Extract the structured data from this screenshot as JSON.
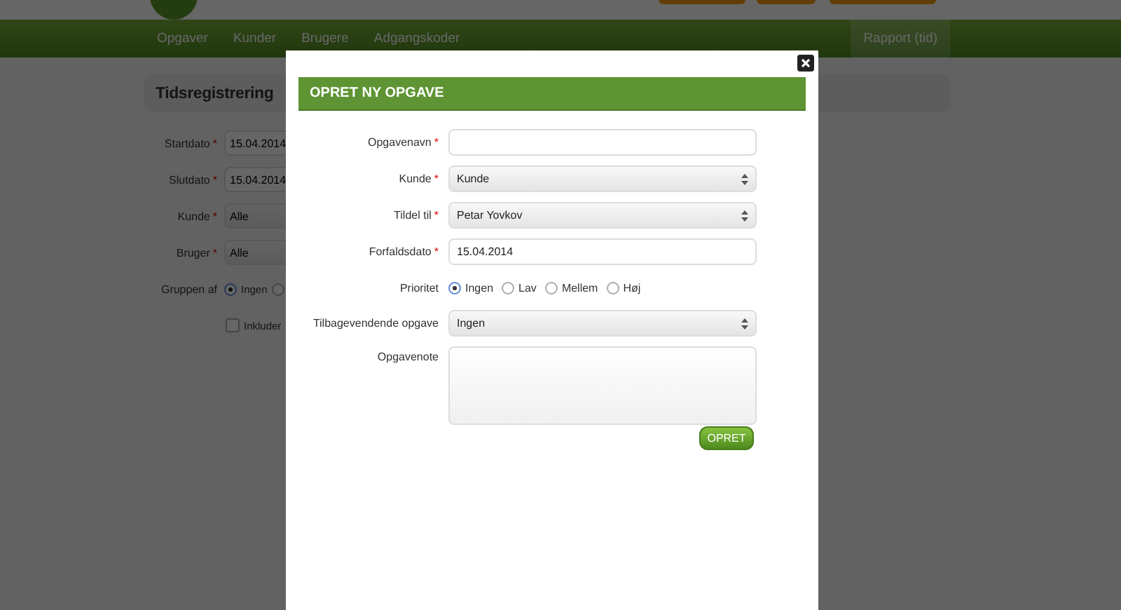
{
  "header": {
    "nav": [
      {
        "label": "Opgaver",
        "selected": false
      },
      {
        "label": "Kunder",
        "selected": false
      },
      {
        "label": "Brugere",
        "selected": false
      },
      {
        "label": "Adgangskoder",
        "selected": false
      }
    ],
    "nav_right": {
      "label": "Rapport (tid)",
      "selected": true
    }
  },
  "page": {
    "title": "Tidsregistrering",
    "filters": [
      {
        "kind": "text",
        "label": "Startdato",
        "mark": "*",
        "value": "15.04.2014"
      },
      {
        "kind": "text",
        "label": "Slutdato",
        "mark": "*",
        "value": "15.04.2014"
      },
      {
        "kind": "select",
        "label": "Kunde",
        "mark": "*",
        "value": "Alle"
      },
      {
        "kind": "select",
        "label": "Bruger",
        "mark": "*",
        "value": "Alle"
      },
      {
        "kind": "radio",
        "label": "Gruppen af",
        "options": [
          {
            "label": "Ingen",
            "selected": true
          },
          {
            "selected": false
          }
        ]
      },
      {
        "kind": "checkbox",
        "label": "Inkluder",
        "checked": false
      }
    ]
  },
  "modal": {
    "title": "OPRET NY OPGAVE",
    "fields": [
      {
        "kind": "text",
        "label": "Opgavenavn",
        "mark": "*"
      },
      {
        "kind": "select",
        "label": "Kunde",
        "mark": "*",
        "value": "Kunde"
      },
      {
        "kind": "select",
        "label": "Tildel til",
        "mark": "*",
        "value": "Petar Yovkov"
      },
      {
        "kind": "text",
        "label": "Forfaldsdato",
        "mark": "*",
        "value": "15.04.2014"
      },
      {
        "kind": "radio",
        "label": "Prioritet",
        "options": [
          {
            "label": "Ingen",
            "selected": true
          },
          {
            "label": "Lav",
            "selected": false
          },
          {
            "label": "Mellem",
            "selected": false
          },
          {
            "label": "Høj",
            "selected": false
          }
        ]
      },
      {
        "kind": "select",
        "label": "Tilbagevendende opgave",
        "value": "Ingen"
      },
      {
        "kind": "textarea",
        "label": "Opgavenote"
      }
    ],
    "submit": "OPRET"
  }
}
